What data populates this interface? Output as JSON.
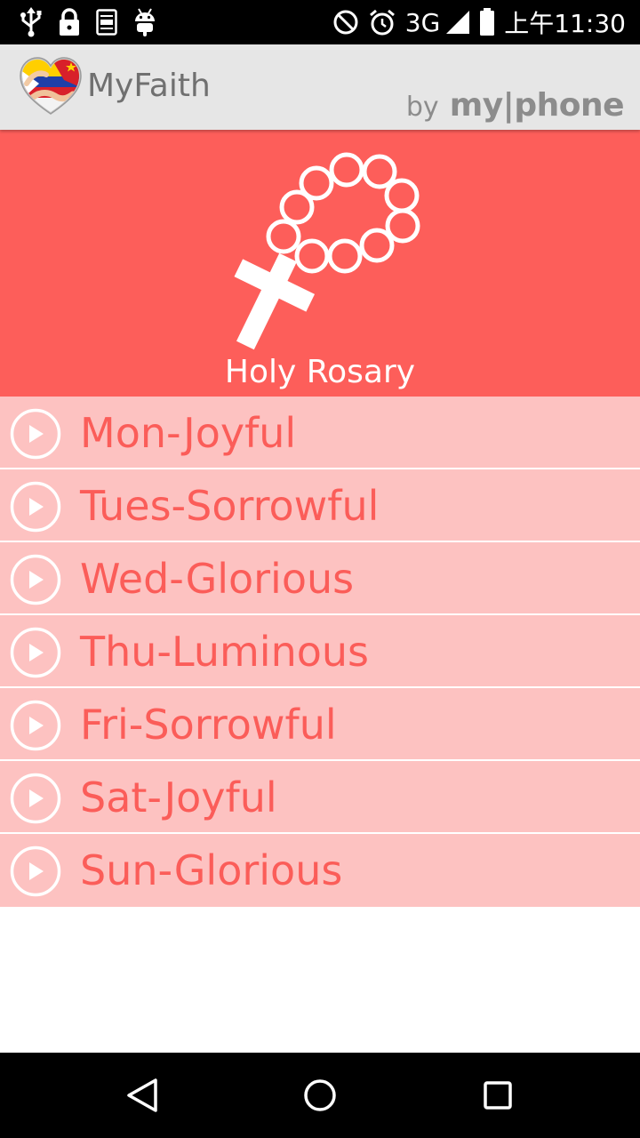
{
  "status_bar": {
    "network": "3G",
    "time": "上午11:30"
  },
  "app_bar": {
    "title": "MyFaith",
    "brand_by": "by",
    "brand_name": "my|phone"
  },
  "banner": {
    "title": "Holy Rosary",
    "icon": "rosary-icon",
    "background": "#fd5e5a"
  },
  "mysteries": [
    {
      "label": "Mon-Joyful"
    },
    {
      "label": "Tues-Sorrowful"
    },
    {
      "label": "Wed-Glorious"
    },
    {
      "label": "Thu-Luminous"
    },
    {
      "label": "Fri-Sorrowful"
    },
    {
      "label": "Sat-Joyful"
    },
    {
      "label": "Sun-Glorious"
    }
  ],
  "colors": {
    "accent": "#fd5e5a",
    "list_background": "#fdc2c1",
    "app_bar_background": "#e6e6e6"
  }
}
